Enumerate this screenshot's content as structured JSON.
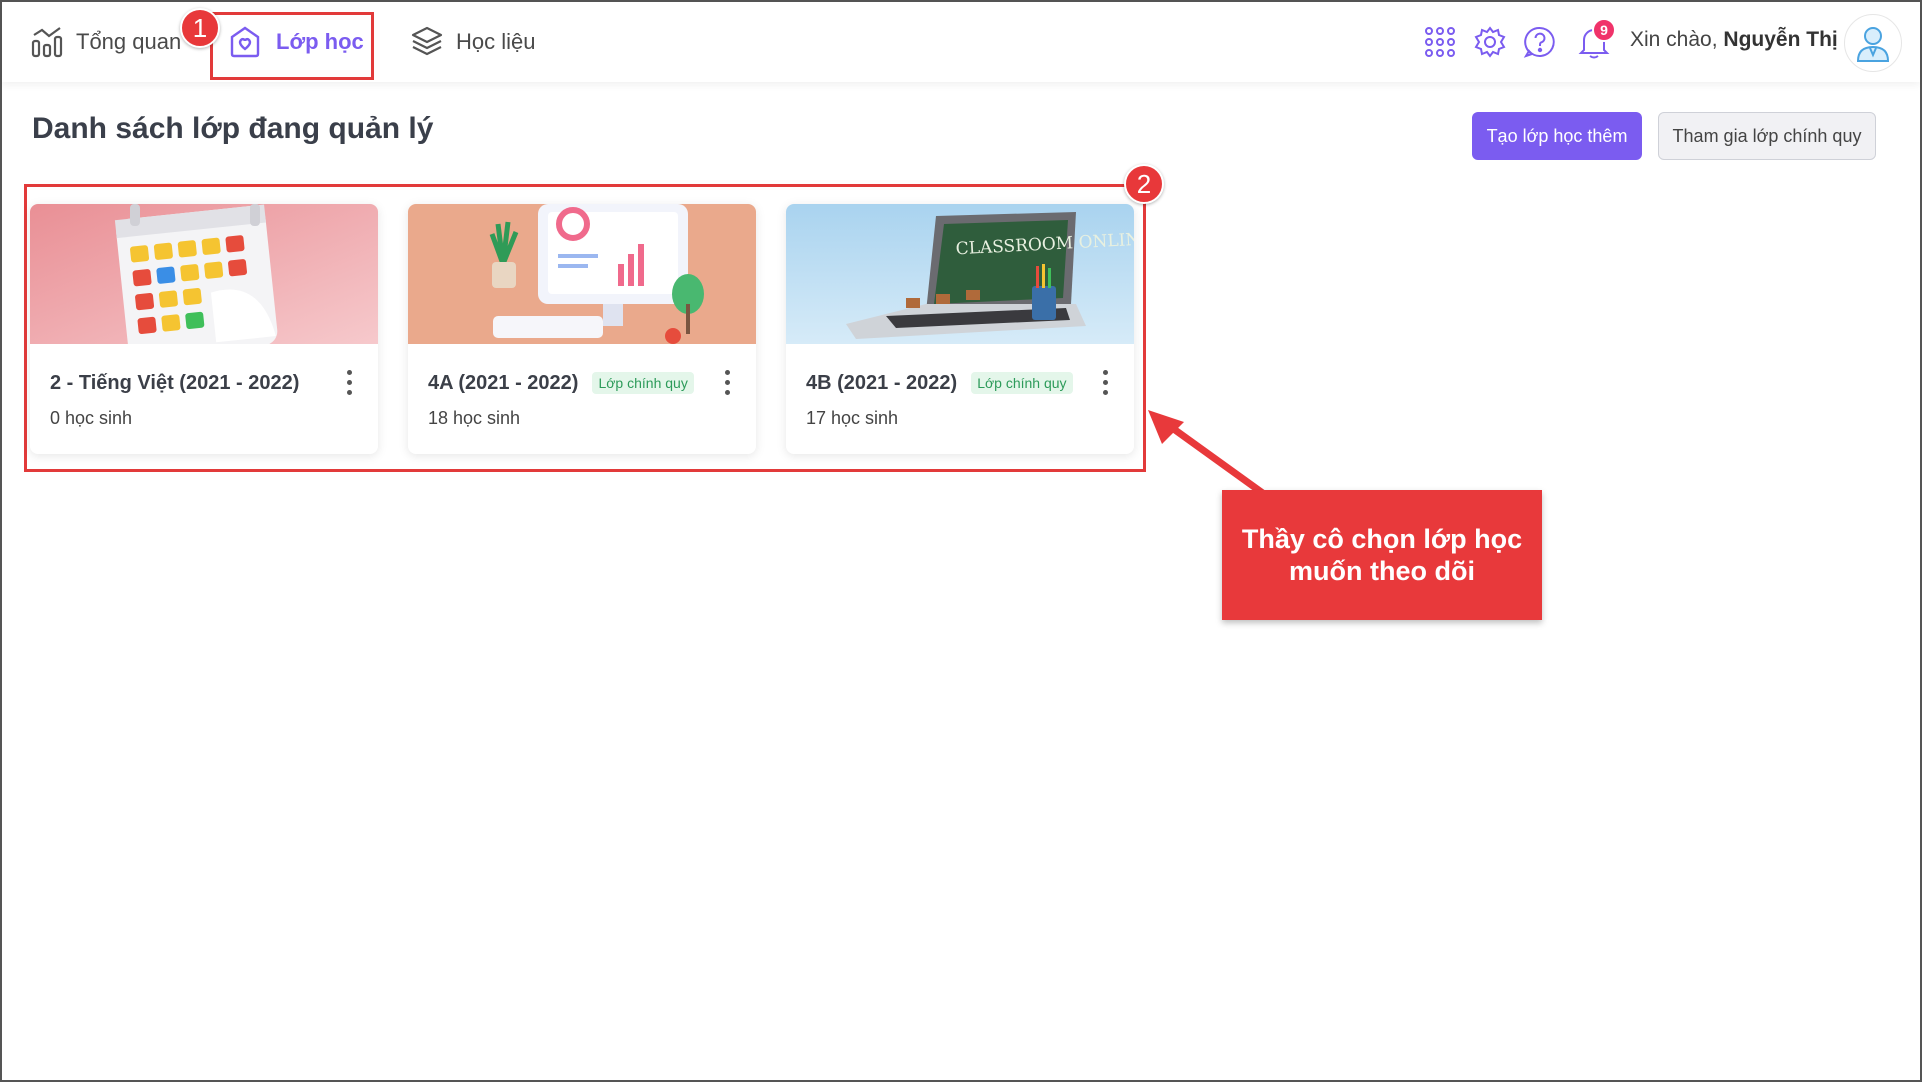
{
  "nav": {
    "items": [
      {
        "label": "Tổng quan",
        "icon": "bar-chart-icon"
      },
      {
        "label": "Lớp học",
        "icon": "school-icon",
        "active": true
      },
      {
        "label": "Học liệu",
        "icon": "layers-icon"
      }
    ]
  },
  "header": {
    "notification_count": "9",
    "greeting_prefix": "Xin chào,",
    "user_name": "Nguyễn Thị",
    "icons": [
      "apps-grid-icon",
      "gear-icon",
      "help-icon",
      "bell-icon",
      "user-avatar-icon"
    ]
  },
  "page": {
    "title": "Danh sách lớp đang quản lý",
    "create_button": "Tạo lớp học thêm",
    "join_button": "Tham gia lớp chính quy"
  },
  "classes": [
    {
      "title": "2 - Tiếng Việt (2021 - 2022)",
      "tag": "",
      "students": "0 học sinh",
      "image": "calendar-illustration"
    },
    {
      "title": "4A (2021 - 2022)",
      "tag": "Lớp chính quy",
      "students": "18 học sinh",
      "image": "computer-illustration"
    },
    {
      "title": "4B (2021 - 2022)",
      "tag": "Lớp chính quy",
      "students": "17 học sinh",
      "image": "classroom-online-laptop"
    }
  ],
  "annotations": {
    "step1": "1",
    "step2": "2",
    "callout": "Thầy cô chọn lớp học muốn theo dõi",
    "chalkboard_text": "CLASSROOM ONLINE"
  },
  "colors": {
    "accent": "#7b5cf0",
    "highlight": "#e23a3a",
    "tag_green": "#2d9b5a",
    "badge_pink": "#f0336a"
  }
}
